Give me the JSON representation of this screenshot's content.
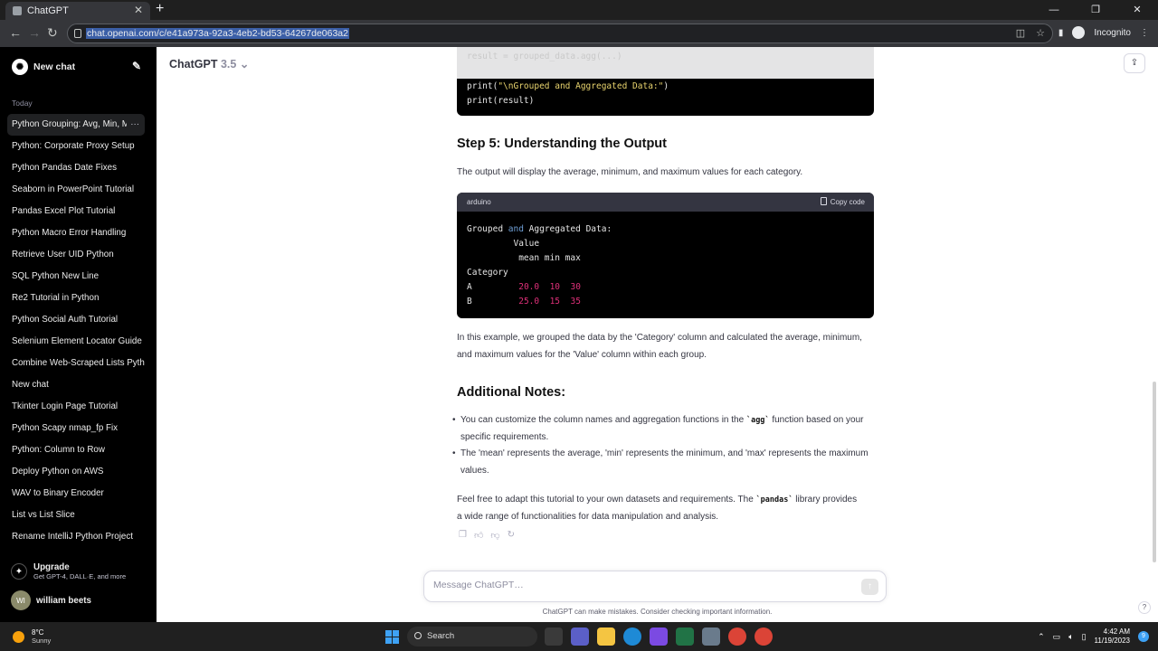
{
  "browser": {
    "tab_title": "ChatGPT",
    "url": "chat.openai.com/c/e41a973a-92a3-4eb2-bd53-64267de063a2",
    "profile_label": "Incognito"
  },
  "sidebar": {
    "new_chat_label": "New chat",
    "section_today": "Today",
    "items": [
      {
        "label": "Python Grouping: Avg, Min, Max",
        "active": true
      },
      {
        "label": "Python: Corporate Proxy Setup"
      },
      {
        "label": "Python Pandas Date Fixes"
      },
      {
        "label": "Seaborn in PowerPoint Tutorial"
      },
      {
        "label": "Pandas Excel Plot Tutorial"
      },
      {
        "label": "Python Macro Error Handling"
      },
      {
        "label": "Retrieve User UID Python"
      },
      {
        "label": "SQL Python New Line"
      },
      {
        "label": "Re2 Tutorial in Python"
      },
      {
        "label": "Python Social Auth Tutorial"
      },
      {
        "label": "Selenium Element Locator Guide"
      },
      {
        "label": "Combine Web-Scraped Lists Python"
      },
      {
        "label": "New chat"
      },
      {
        "label": "Tkinter Login Page Tutorial"
      },
      {
        "label": "Python Scapy nmap_fp Fix"
      },
      {
        "label": "Python: Column to Row"
      },
      {
        "label": "Deploy Python on AWS"
      },
      {
        "label": "WAV to Binary Encoder"
      },
      {
        "label": "List vs List Slice"
      },
      {
        "label": "Rename IntelliJ Python Project"
      }
    ],
    "more_label": "···",
    "upgrade_title": "Upgrade",
    "upgrade_sub": "Get GPT-4, DALL·E, and more",
    "user_initials": "WI",
    "user_name": "william beets"
  },
  "header": {
    "model": "ChatGPT",
    "model_version": "3.5",
    "model_chevron": "⌄"
  },
  "content": {
    "code_top_faded": "result = grouped_data.agg(...)",
    "code_top_line1_pre": "print(",
    "code_top_line1_str": "\"\\nGrouped and Aggregated Data:\"",
    "code_top_line1_post": ")",
    "code_top_line2": "print(result)",
    "step5_heading": "Step 5: Understanding the Output",
    "step5_text": "The output will display the average, minimum, and maximum values for each category.",
    "codeblock_lang": "arduino",
    "copy_label": "Copy code",
    "output": {
      "line1_a": "Grouped ",
      "line1_kw": "and",
      "line1_b": " Aggregated Data:",
      "line2": "         Value",
      "line3": "          mean min max",
      "line4": "Category",
      "rows": [
        {
          "cat": "A",
          "mean": "20.0",
          "min": "10",
          "max": "30"
        },
        {
          "cat": "B",
          "mean": "25.0",
          "min": "15",
          "max": "35"
        }
      ]
    },
    "example_text": "In this example, we grouped the data by the 'Category' column and calculated the average, minimum, and maximum values for the 'Value' column within each group.",
    "notes_heading": "Additional Notes:",
    "bullet1_a": "You can customize the column names and aggregation functions in the ",
    "bullet1_code": "`agg`",
    "bullet1_b": " function based on your specific requirements.",
    "bullet2": "The 'mean' represents the average, 'min' represents the minimum, and 'max' represents the maximum values.",
    "final_a": "Feel free to adapt this tutorial to your own datasets and requirements. The ",
    "final_code": "`pandas`",
    "final_b": " library provides a wide range of functionalities for data manipulation and analysis."
  },
  "composer": {
    "placeholder": "Message ChatGPT…",
    "disclaimer": "ChatGPT can make mistakes. Consider checking important information."
  },
  "taskbar": {
    "temp": "8°C",
    "weather": "Sunny",
    "search_label": "Search",
    "time": "4:42 AM",
    "date": "11/19/2023",
    "notif_count": "9"
  },
  "colors": {
    "sidebar_bg": "#000000",
    "code_bg": "#000000",
    "code_number": "#df3079",
    "code_keyword": "#6f9fd6",
    "url_highlight": "#3b5fa7"
  }
}
